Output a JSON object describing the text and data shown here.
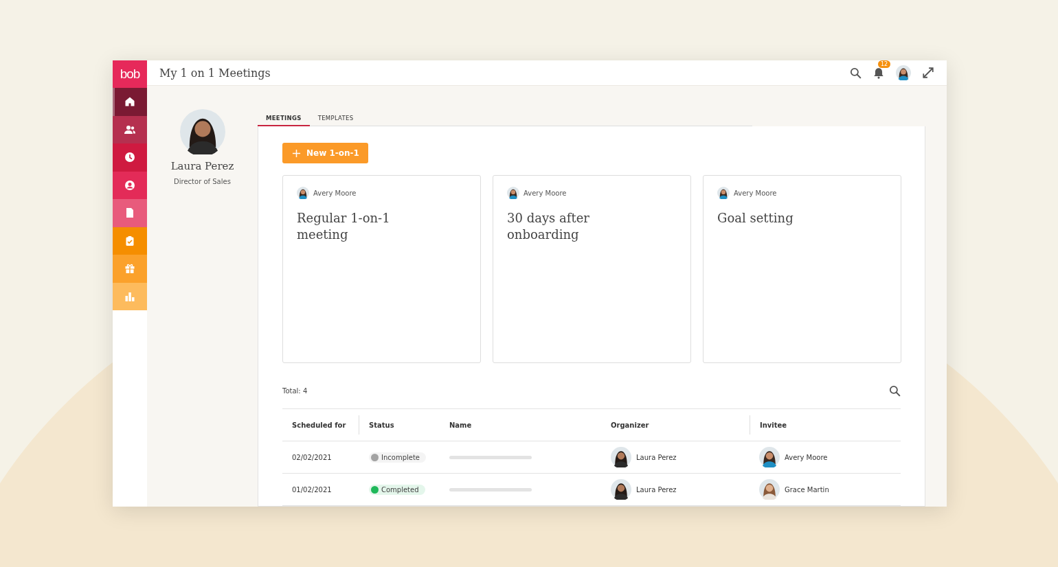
{
  "sidebar": {
    "logo": "bob",
    "items": [
      {
        "kind": "home",
        "color": "#7a1a33",
        "selected": true
      },
      {
        "kind": "people",
        "color": "#b5304f",
        "selected": false
      },
      {
        "kind": "clock",
        "color": "#cf1a40",
        "selected": false
      },
      {
        "kind": "person",
        "color": "#e32b58",
        "selected": false
      },
      {
        "kind": "document",
        "color": "#e85b7c",
        "selected": false
      },
      {
        "kind": "clipboard",
        "color": "#f58e00",
        "selected": false
      },
      {
        "kind": "gift",
        "color": "#fba12b",
        "selected": false
      },
      {
        "kind": "chart",
        "color": "#fdbb5d",
        "selected": false
      }
    ]
  },
  "header": {
    "title": "My 1 on 1 Meetings",
    "notifications": "12"
  },
  "profile": {
    "name": "Laura Perez",
    "role": "Director of Sales"
  },
  "tabs": [
    {
      "label": "MEETINGS",
      "selected": true
    },
    {
      "label": "TEMPLATES",
      "selected": false
    }
  ],
  "new_button": "New 1-on-1",
  "cards": [
    {
      "owner": "Avery Moore",
      "title": "Regular 1-on-1 meeting"
    },
    {
      "owner": "Avery Moore",
      "title": "30 days after onboarding"
    },
    {
      "owner": "Avery Moore",
      "title": "Goal setting"
    }
  ],
  "table": {
    "total": "Total: 4",
    "columns": [
      "Scheduled for",
      "Status",
      "Name",
      "Organizer",
      "Invitee"
    ],
    "rows": [
      {
        "date": "02/02/2021",
        "status": "Incomplete",
        "color": "#a3a3a3",
        "organizer": "Laura Perez",
        "invitee": "Avery Moore"
      },
      {
        "date": "01/02/2021",
        "status": "Completed",
        "color": "#1fb85a",
        "organizer": "Laura Perez",
        "invitee": "Grace Martin"
      }
    ]
  }
}
